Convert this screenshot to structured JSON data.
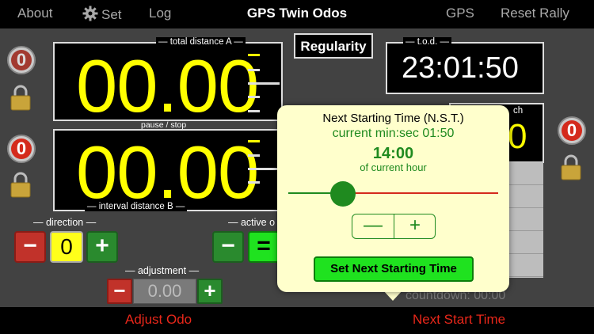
{
  "topbar": {
    "about": "About",
    "set": "Set",
    "log": "Log",
    "title": "GPS Twin Odos",
    "gps": "GPS",
    "reset_rally": "Reset Rally"
  },
  "odo_a": {
    "caption": "— total distance A —",
    "value": "00.00",
    "counter": "0"
  },
  "odo_b": {
    "top_caption": "pause / stop",
    "caption": "— interval distance B —",
    "value": "00.00",
    "counter": "0"
  },
  "regularity": {
    "label": "Regularity"
  },
  "tod": {
    "caption": "— t.o.d. —",
    "value": "23:01:50"
  },
  "right_panel": {
    "caption_fragment": "ch",
    "digit": "0",
    "counter": "0"
  },
  "direction": {
    "caption": "— direction —",
    "minus": "−",
    "value": "0",
    "plus": "+"
  },
  "active": {
    "caption": "— active o",
    "minus": "−",
    "equals": "="
  },
  "adjustment": {
    "caption": "— adjustment —",
    "minus": "−",
    "value": "0.00",
    "plus": "+"
  },
  "countdown": "countdown: 00:00",
  "bottombar": {
    "adjust_odo": "Adjust Odo",
    "next_start_time": "Next Start Time"
  },
  "popover": {
    "title": "Next Starting Time (N.S.T.)",
    "current": "current min:sec 01:50",
    "time": "14:00",
    "of_hour": "of current hour",
    "slider_fraction": 0.26,
    "stepper_minus": "—",
    "stepper_plus": "+",
    "set_button": "Set Next Starting Time"
  },
  "colors": {
    "digit_yellow": "#ffff00",
    "accent_red": "#e8271a",
    "accent_green": "#1f8a1f",
    "popover_bg": "#ffffcc"
  }
}
